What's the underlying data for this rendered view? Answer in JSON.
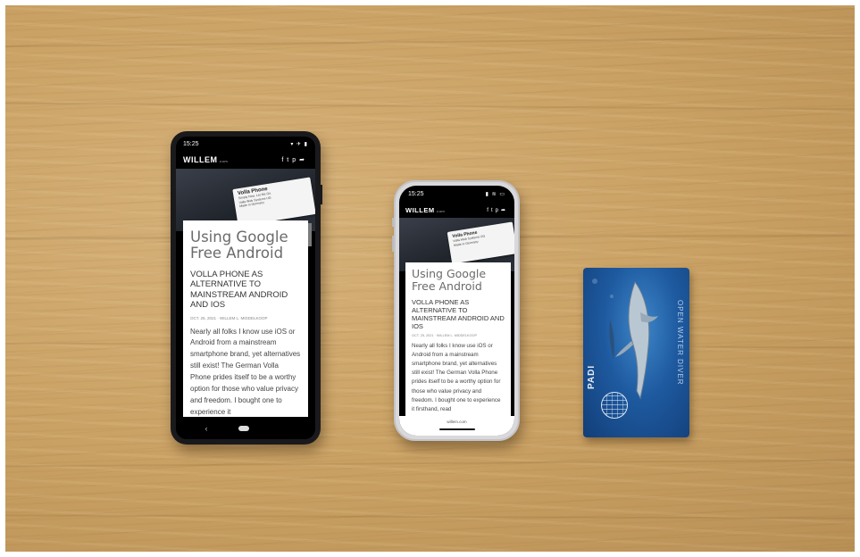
{
  "scene": {
    "surface": "light oak wooden table",
    "colors": {
      "wood": "#c9a063",
      "card_blue": "#1e5aa0",
      "phone_dark": "#1a1a1d",
      "phone_silver": "#d9d9dc"
    }
  },
  "android_phone": {
    "status_time": "15:25",
    "brand": "WILLEM",
    "brand_suffix": ".com",
    "hero_card": {
      "title": "Volla Phone",
      "line1": "Simply Now. Let Me Go.",
      "line2": "Volla Web Systems UG",
      "line3": "Made in Germany"
    },
    "article": {
      "title": "Using Google Free Android",
      "subtitle": "VOLLA PHONE AS ALTERNATIVE TO MAINSTREAM ANDROID AND IOS",
      "meta": "OCT. 25, 2021 · WILLEM L. MIDDELKOOP",
      "body": "Nearly all folks I know use iOS or Android from a mainstream smartphone brand, yet alternatives still exist! The German Volla Phone prides itself to be a worthy option for those who value privacy and freedom. I bought one to experience it"
    },
    "icons": [
      "facebook-icon",
      "twitter-icon",
      "pinterest-icon",
      "share-icon",
      "back-icon",
      "home-icon"
    ]
  },
  "iphone": {
    "status_time": "15:25",
    "brand": "WILLEM",
    "brand_suffix": ".com",
    "hero_card": {
      "title": "Volla Phone",
      "line1": "Volla Web Systems UG",
      "line2": "Made in Germany"
    },
    "article": {
      "title": "Using Google Free Android",
      "subtitle": "VOLLA PHONE AS ALTERNATIVE TO MAINSTREAM ANDROID AND IOS",
      "meta": "OCT. 25, 2021 · WILLEM L. MIDDELKOOP",
      "body": "Nearly all folks I know use iOS or Android from a mainstream smartphone brand, yet alternatives still exist! The German Volla Phone prides itself to be a worthy option for those who value privacy and freedom. I bought one to experience it firsthand, read"
    },
    "url": "willem.com",
    "icons": [
      "facebook-icon",
      "twitter-icon",
      "pinterest-icon",
      "share-icon"
    ]
  },
  "dive_card": {
    "logo": "PADI",
    "vertical_text": "OPEN WATER DIVER",
    "icons": [
      "dolphin-icon",
      "globe-icon"
    ]
  }
}
